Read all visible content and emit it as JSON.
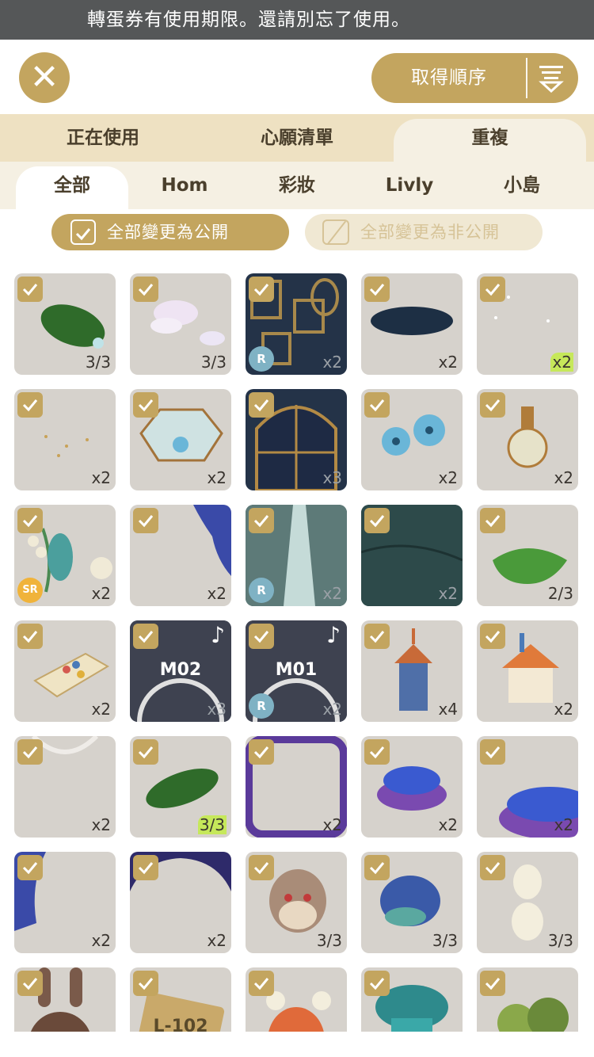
{
  "notice": "轉蛋券有使用期限。還請別忘了使用。",
  "header": {
    "close_icon": "close-icon",
    "order_label": "取得順序",
    "sort_icon": "sort-icon"
  },
  "tabs": [
    {
      "label": "正在使用",
      "active": false
    },
    {
      "label": "心願清單",
      "active": false
    },
    {
      "label": "重複",
      "active": true
    }
  ],
  "subtabs": [
    {
      "label": "全部",
      "active": true
    },
    {
      "label": "Hom",
      "active": false
    },
    {
      "label": "彩妝",
      "active": false
    },
    {
      "label": "Livly",
      "active": false
    },
    {
      "label": "小島",
      "active": false
    }
  ],
  "actions": {
    "public_label": "全部變更為公開",
    "private_label": "全部變更為非公開"
  },
  "colors": {
    "accent": "#c3a55f",
    "tab_bg": "#eee1c2",
    "subtab_bg": "#f5f0e3",
    "highlight": "#c6e85a"
  },
  "items": [
    {
      "name": "leaf-with-dew",
      "count": "3/3",
      "checked": true
    },
    {
      "name": "soap-bubbles",
      "count": "3/3",
      "checked": true
    },
    {
      "name": "picture-frames-wallpaper",
      "count": "x2",
      "rarity": "R",
      "checked": true
    },
    {
      "name": "starry-puddle",
      "count": "x2",
      "checked": true
    },
    {
      "name": "sparkle-dust",
      "count": "x2",
      "highlight": true,
      "checked": true
    },
    {
      "name": "golden-glitter",
      "count": "x2",
      "checked": true
    },
    {
      "name": "glass-terrarium",
      "count": "x2",
      "checked": true
    },
    {
      "name": "arched-night-window",
      "count": "x3",
      "checked": true
    },
    {
      "name": "blue-flowers",
      "count": "x2",
      "checked": true
    },
    {
      "name": "flower-perfume-bottle",
      "count": "x2",
      "checked": true
    },
    {
      "name": "lily-of-the-valley",
      "count": "x2",
      "rarity": "SR",
      "checked": true
    },
    {
      "name": "blue-ink-frame",
      "count": "x2",
      "checked": true
    },
    {
      "name": "misty-forest-path",
      "count": "x2",
      "rarity": "R",
      "checked": true
    },
    {
      "name": "stone-floor",
      "count": "x2",
      "checked": true
    },
    {
      "name": "green-leaf-hat",
      "count": "2/3",
      "checked": true
    },
    {
      "name": "eyeshadow-palette",
      "count": "x2",
      "checked": true
    },
    {
      "name": "music-record-m02",
      "count": "x3",
      "overlay": "M02",
      "music": true,
      "checked": true
    },
    {
      "name": "music-record-m01",
      "count": "x2",
      "overlay": "M01",
      "rarity": "R",
      "music": true,
      "checked": true
    },
    {
      "name": "birdhouse-tall",
      "count": "x4",
      "checked": true
    },
    {
      "name": "pencil-cottage",
      "count": "x2",
      "checked": true
    },
    {
      "name": "lace-frame",
      "count": "x2",
      "checked": true
    },
    {
      "name": "monstera-leaf",
      "count": "3/3",
      "highlight": true,
      "checked": true
    },
    {
      "name": "purple-frame",
      "count": "x2",
      "checked": true
    },
    {
      "name": "blue-cushion",
      "count": "x2",
      "checked": true
    },
    {
      "name": "blue-cushion-large",
      "count": "x2",
      "checked": true
    },
    {
      "name": "blue-corner-ink",
      "count": "x2",
      "checked": true
    },
    {
      "name": "purple-arch-frame",
      "count": "x2",
      "checked": true
    },
    {
      "name": "bunny-egg",
      "count": "3/3",
      "checked": true
    },
    {
      "name": "blue-fuzzy-creature",
      "count": "3/3",
      "checked": true
    },
    {
      "name": "chick-eggs",
      "count": "3/3",
      "checked": true
    },
    {
      "name": "bunny-plush",
      "count": "",
      "checked": true
    },
    {
      "name": "license-plate",
      "count": "",
      "plate": "L-102",
      "checked": true
    },
    {
      "name": "orange-creature",
      "count": "",
      "checked": true
    },
    {
      "name": "mushroom-creature",
      "count": "",
      "checked": true
    },
    {
      "name": "bush-creatures",
      "count": "",
      "checked": true
    }
  ]
}
